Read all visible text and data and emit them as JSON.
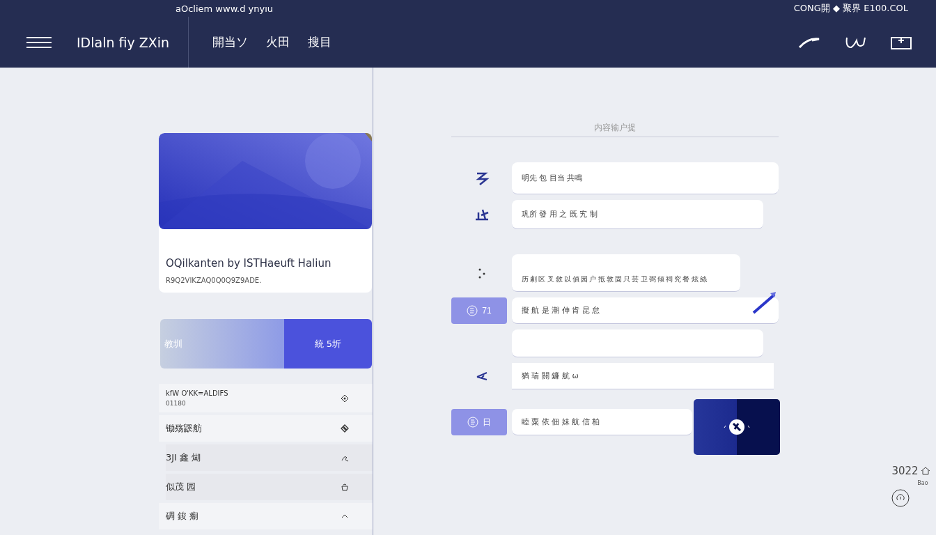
{
  "status_bar": {
    "center": "aOcliem www.d ynyıu",
    "right": "CONG開 ◆ 聚界 E100.COL"
  },
  "header": {
    "title": "IDlaln fiy ZXin",
    "nav": [
      {
        "label": "開当ソ"
      },
      {
        "label": "火田"
      },
      {
        "label": "搜目"
      }
    ]
  },
  "card": {
    "title": "OQilkanten by ISTHaeuft Haliun",
    "subtitle": "R9Q2VIKZAQ0Q0Q9Z9ADE."
  },
  "segments": [
    {
      "label": "教圳",
      "selected": false
    },
    {
      "label": "統 5圻",
      "selected": true
    }
  ],
  "list": [
    {
      "label": "kfW O'KK=ALDIFS",
      "sublabel": "01180",
      "highlighted": false
    },
    {
      "label": "锄殇鼷舫",
      "highlighted": false
    },
    {
      "label": "3JI 鑫 煳",
      "highlighted": true
    },
    {
      "label": "似茂 园",
      "highlighted": true
    },
    {
      "label": "碉 鋑 痸",
      "highlighted": false
    }
  ],
  "form": {
    "heading": "内容输户提",
    "rows": [
      {
        "kind": "icon",
        "value": "明先 包 目当 共鳴"
      },
      {
        "kind": "icon",
        "value": "巩所 發 用 之 既 宄 制"
      },
      {
        "kind": "textarea",
        "value": "历 劇 区 叉 敘 以 偵 园 户 抵 敦 固 只 芸 卫 弼 倾 祠 究 餐 炫 絲"
      },
      {
        "kind": "button",
        "button": "71",
        "value": "擬 航 是 潮 伸 肯 昆 怠"
      },
      {
        "kind": "blank"
      },
      {
        "kind": "icon",
        "value": "猶 瑞 關 鐮 航 ω"
      },
      {
        "kind": "button",
        "button": "日",
        "value": "睦 粟 依 佃 妹 航 信 柏"
      }
    ]
  },
  "corner": {
    "label": "3022",
    "sublabel": "Bao"
  }
}
